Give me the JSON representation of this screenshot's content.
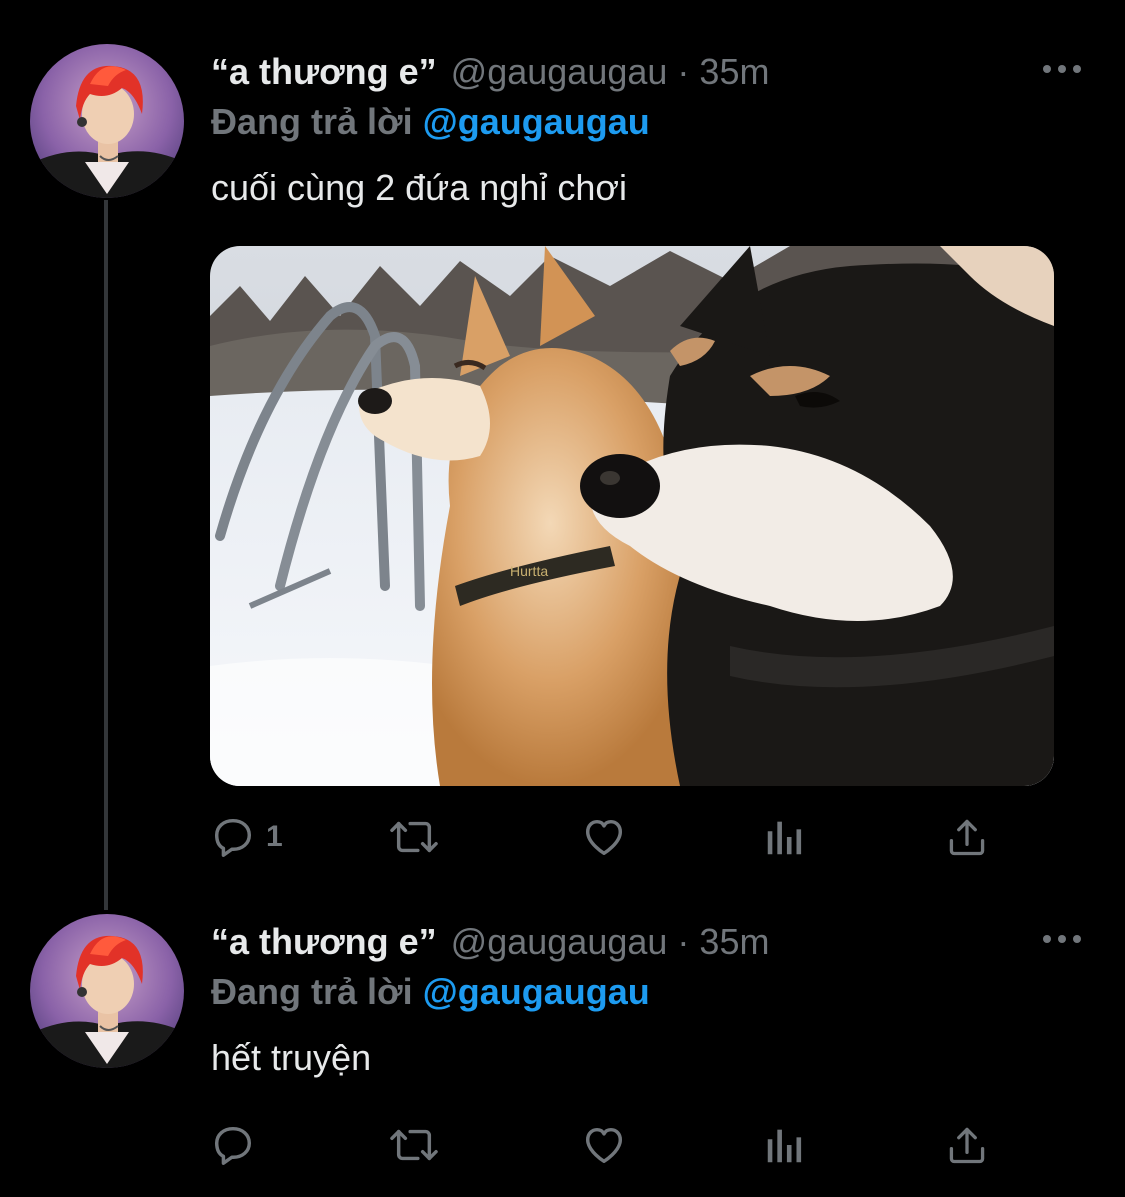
{
  "colors": {
    "background": "#000000",
    "text_primary": "#e7e9ea",
    "text_secondary": "#71767b",
    "accent": "#1d9bf0",
    "thread_line": "#333639"
  },
  "tweets": [
    {
      "display_name": "“a thương e”",
      "handle": "@gaugaugau",
      "separator": "·",
      "time": "35m",
      "reply_prefix": "Đang trả lời",
      "reply_mention": "@gaugaugau",
      "text": "cuối cùng 2 đứa nghỉ chơi",
      "has_media": true,
      "media_label": "Hurtta",
      "actions": {
        "reply_icon": "reply-icon",
        "reply_count": "1",
        "retweet_icon": "retweet-icon",
        "like_icon": "heart-icon",
        "stats_icon": "bar-chart-icon",
        "share_icon": "share-icon"
      }
    },
    {
      "display_name": "“a thương e”",
      "handle": "@gaugaugau",
      "separator": "·",
      "time": "35m",
      "reply_prefix": "Đang trả lời",
      "reply_mention": "@gaugaugau",
      "text": "hết truyện",
      "has_media": false,
      "actions": {
        "reply_icon": "reply-icon",
        "reply_count": "",
        "retweet_icon": "retweet-icon",
        "like_icon": "heart-icon",
        "stats_icon": "bar-chart-icon",
        "share_icon": "share-icon"
      }
    }
  ]
}
